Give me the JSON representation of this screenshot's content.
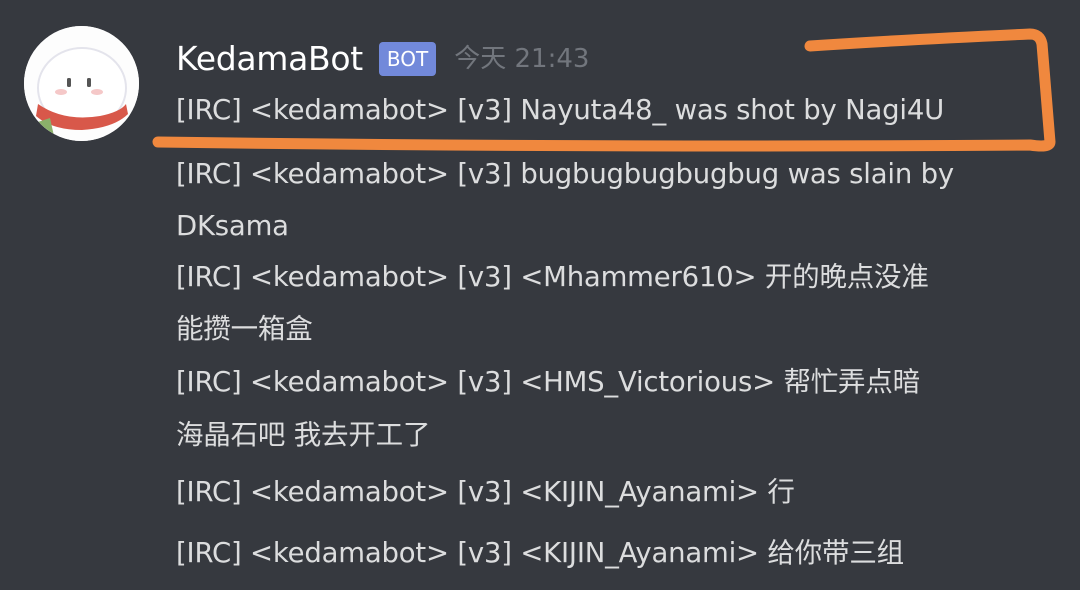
{
  "message": {
    "username": "KedamaBot",
    "bot_tag": "BOT",
    "timestamp": "今天 21:43",
    "avatar_icon": "kedama-avatar-icon",
    "lines": [
      "[IRC] <kedamabot> [v3] Nayuta48_ was shot by Nagi4U",
      "[IRC] <kedamabot> [v3] bugbugbugbugbug was slain by",
      "DKsama",
      "[IRC] <kedamabot> [v3] <Mhammer610> 开的晚点没准",
      "能攒一箱盒",
      "[IRC] <kedamabot> [v3] <HMS_Victorious> 帮忙弄点暗",
      "海晶石吧 我去开工了",
      "[IRC] <kedamabot> [v3] <KIJIN_Ayanami> 行",
      "[IRC] <kedamabot> [v3] <KIJIN_Ayanami> 给你带三组"
    ]
  },
  "colors": {
    "background": "#36393f",
    "username": "#ffffff",
    "bot_tag": "#7289da",
    "timestamp": "#72767d",
    "message_text": "#dcddde",
    "annotation": "#f0883e"
  }
}
